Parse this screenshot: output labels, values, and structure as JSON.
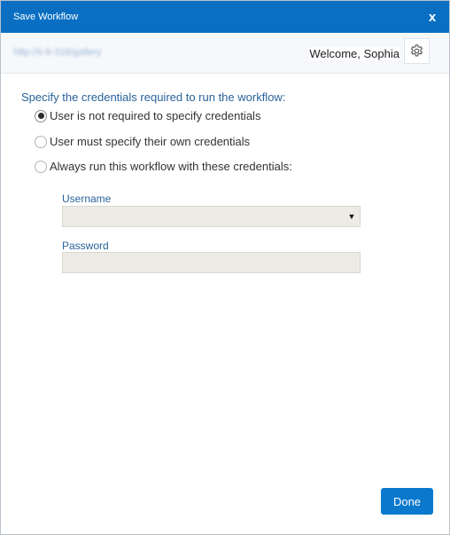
{
  "dialog": {
    "title": "Save Workflow",
    "close_label": "x"
  },
  "header": {
    "url": "http://ii-9-316/gallery",
    "welcome": "Welcome, Sophia"
  },
  "credentials": {
    "heading": "Specify the credentials required to run the workflow:",
    "options": [
      {
        "label": "User is not required to specify credentials",
        "selected": true
      },
      {
        "label": "User must specify their own credentials",
        "selected": false
      },
      {
        "label": "Always run this workflow with these credentials:",
        "selected": false
      }
    ],
    "username_label": "Username",
    "username_value": "",
    "password_label": "Password",
    "password_value": ""
  },
  "footer": {
    "done_label": "Done"
  },
  "colors": {
    "titlebar": "#0a6fc2",
    "accent_text": "#29639b",
    "done_button": "#0a78cc",
    "field_bg": "#ecebe5"
  }
}
